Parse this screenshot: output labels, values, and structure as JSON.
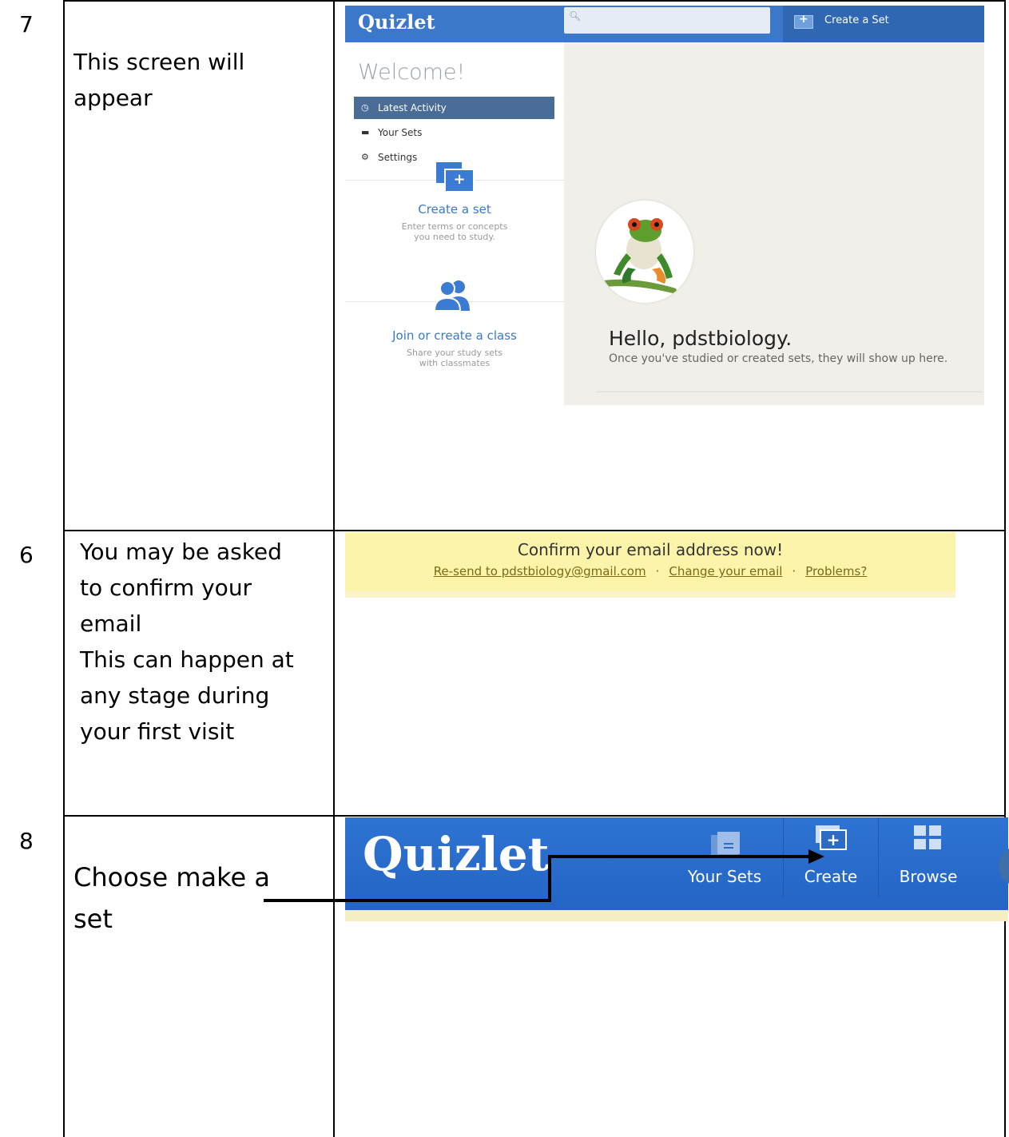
{
  "rows": [
    {
      "number": "7",
      "text": "This screen will\nappear"
    },
    {
      "number": "6",
      "text": "You may be asked\nto confirm your\nemail\nThis can happen at\nany stage during\nyour first visit"
    },
    {
      "number": "8",
      "text": "Choose make a\nset"
    }
  ],
  "shot1": {
    "logo": "Quizlet",
    "create_set": "Create a Set",
    "welcome": "Welcome!",
    "nav": [
      {
        "label": "Latest Activity",
        "icon": "clock-icon"
      },
      {
        "label": "Your Sets",
        "icon": "cards-icon"
      },
      {
        "label": "Settings",
        "icon": "gear-icon"
      }
    ],
    "create_card": {
      "title": "Create a set",
      "subtitle": "Enter terms or concepts\nyou need to study."
    },
    "join_card": {
      "title": "Join or create a class",
      "subtitle": "Share your study sets\nwith classmates"
    },
    "hello": "Hello, pdstbiology.",
    "hello_sub": "Once you've studied or created sets, they will show up here."
  },
  "shot2": {
    "title": "Confirm your email address now!",
    "links": [
      "Re-send to pdstbiology@gmail.com",
      "Change your email",
      "Problems?"
    ],
    "separator": "·"
  },
  "shot3": {
    "logo": "Quizlet",
    "items": [
      {
        "label": "Your Sets",
        "icon": "folder-icon"
      },
      {
        "label": "Create",
        "icon": "create-set-icon"
      },
      {
        "label": "Browse",
        "icon": "grid-icon"
      }
    ]
  },
  "colors": {
    "quizlet_blue": "#3b78c9",
    "banner_yellow": "#fcf4a8",
    "main_bg": "#f0efe9"
  }
}
